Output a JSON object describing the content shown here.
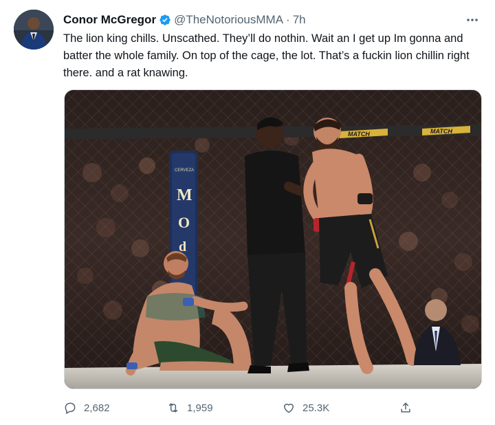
{
  "tweet": {
    "display_name": "Conor McGregor",
    "handle": "@TheNotoriousMMA",
    "separator": "·",
    "timestamp": "7h",
    "text": "The lion king chills. Unscathed. They’ll do nothin. Wait an I get up Im gonna and batter the whole family. On top of the cage, the lot. That’s a fuckin lion chillin right there. and a rat knawing.",
    "more_icon": "more-horizontal-icon"
  },
  "media": {
    "cage_banner_left": "MATCH",
    "cage_banner_right": "MATCH",
    "post_letters": [
      "M",
      "O",
      "d"
    ],
    "post_small_label": "CERVEZA"
  },
  "actions": {
    "reply_count": "2,682",
    "retweet_count": "1,959",
    "like_count": "25.3K",
    "reply_icon": "reply-icon",
    "retweet_icon": "retweet-icon",
    "like_icon": "heart-icon",
    "share_icon": "share-icon"
  },
  "colors": {
    "verified": "#1d9bf0",
    "muted_text": "#536471",
    "primary_text": "#0f1419"
  }
}
